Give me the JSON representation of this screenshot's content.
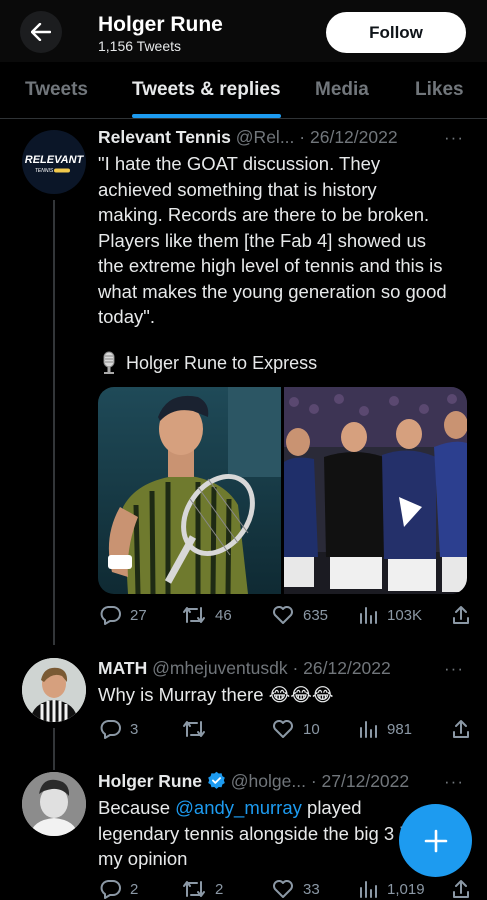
{
  "header": {
    "name": "Holger Rune",
    "tweet_count": "1,156 Tweets",
    "follow_label": "Follow"
  },
  "tabs": [
    {
      "label": "Tweets",
      "active": false
    },
    {
      "label": "Tweets & replies",
      "active": true
    },
    {
      "label": "Media",
      "active": false
    },
    {
      "label": "Likes",
      "active": false
    }
  ],
  "tweets": [
    {
      "author": "Relevant Tennis",
      "handle": "@Rel...",
      "date": "· 26/12/2022",
      "avatar_logo": "RELEVANT",
      "avatar_logo_sub": "TENNIS",
      "text_lines": [
        "\"I hate the GOAT discussion. They",
        "achieved something that is history",
        "making. Records are there to be broken.",
        "Players like them [the Fab 4] showed us",
        "the extreme high level of tennis and this is",
        "what makes the young generation so good",
        "today\"."
      ],
      "quote_icon": "microphone-emoji",
      "quote_text": "Holger Rune to Express",
      "replies": "27",
      "retweets": "46",
      "likes": "635",
      "views": "103K"
    },
    {
      "author": "MATH",
      "handle": "@mhejuventusdk",
      "date": "· 26/12/2022",
      "text": "Why is Murray there",
      "emojis": "😂😂😂",
      "replies": "3",
      "retweets": "",
      "likes": "10",
      "views": "981"
    },
    {
      "author": "Holger Rune",
      "handle": "@holge...",
      "date": "· 27/12/2022",
      "verified": true,
      "text_line1_before": "Because ",
      "text_line1_mention": "@andy_murray",
      "text_line1_after": " played",
      "text_line2": "legendary tennis alongside the big 3 in",
      "text_line3": "my opinion",
      "replies": "2",
      "retweets": "2",
      "likes": "33",
      "views": "1,019"
    }
  ],
  "more_label": "···",
  "colors": {
    "accent": "#1d9bf0",
    "muted": "#71767b",
    "text": "#e7e9ea",
    "divider": "#2f3336"
  },
  "icons": {
    "back": "arrow-left-icon",
    "reply": "comment-icon",
    "retweet": "retweet-icon",
    "like": "heart-icon",
    "views": "analytics-bars-icon",
    "share": "share-up-icon",
    "compose": "plus-icon",
    "verified": "verified-badge-icon"
  }
}
